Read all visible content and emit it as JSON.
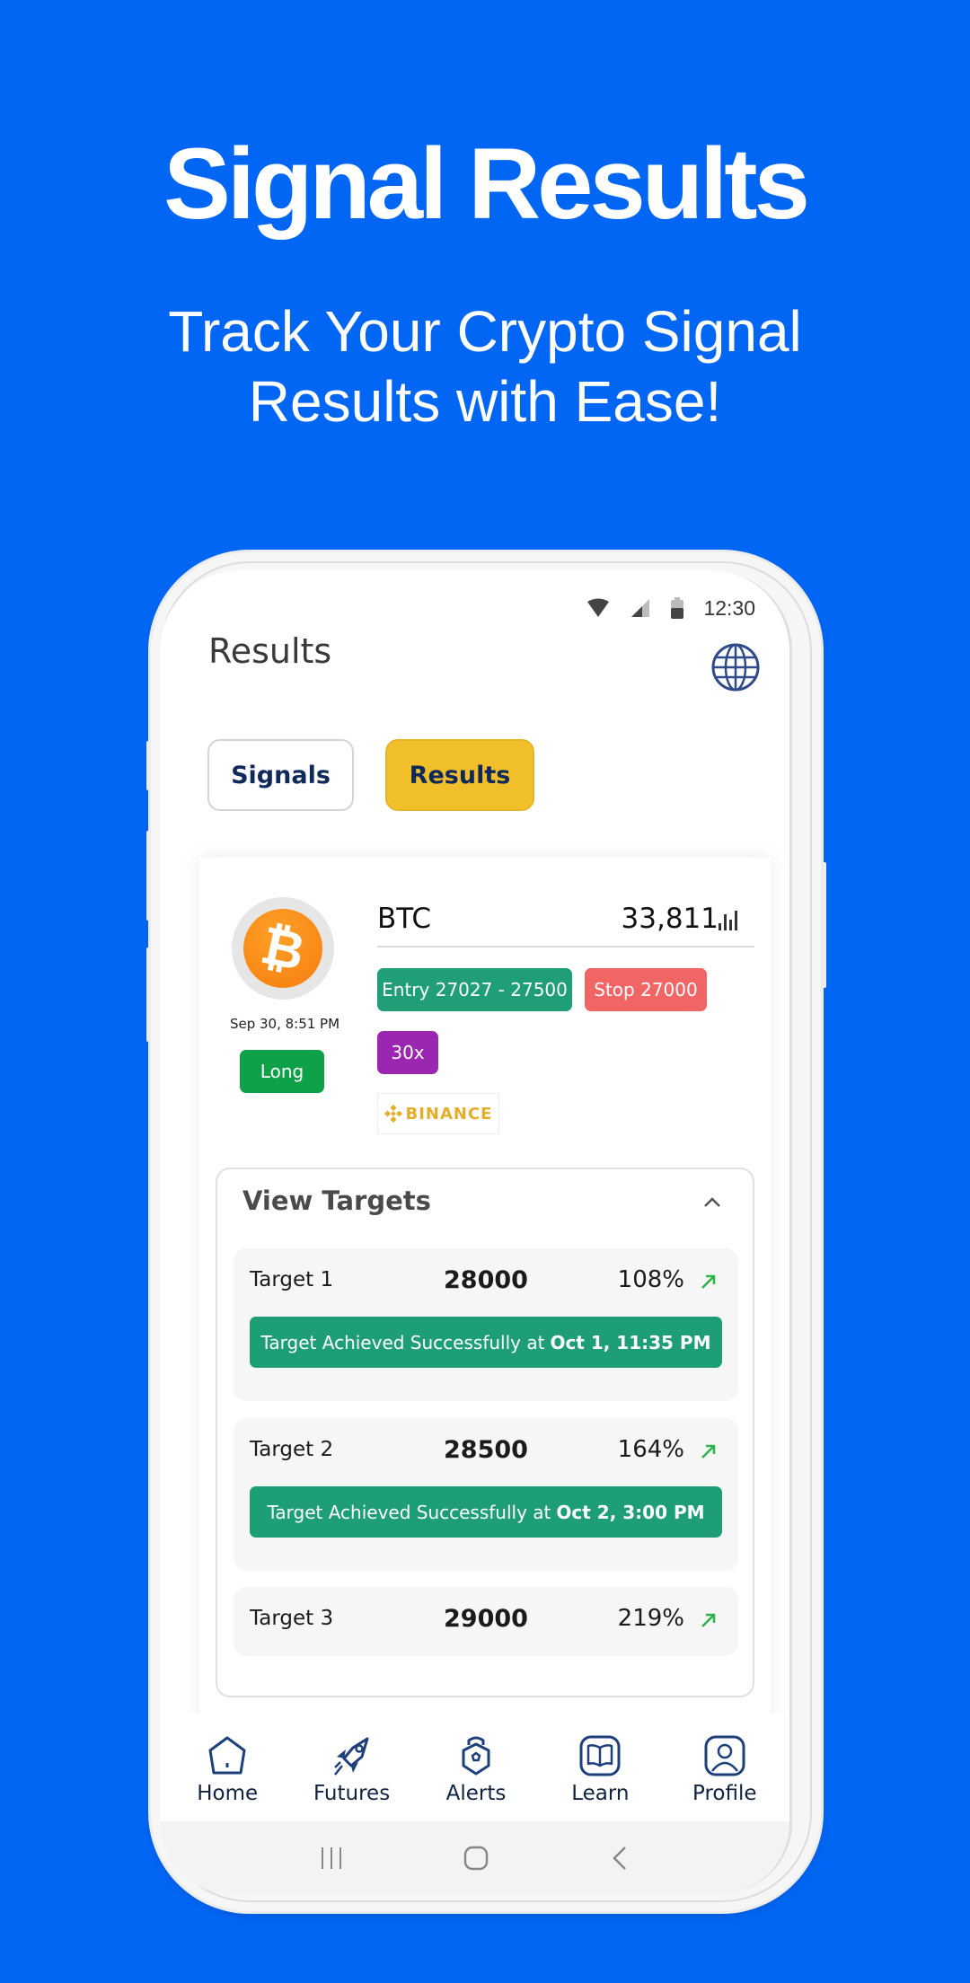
{
  "hero": {
    "title": "Signal Results",
    "subtitle_line1": "Track Your Crypto Signal",
    "subtitle_line2": "Results with Ease!"
  },
  "colors": {
    "background": "#0166f4",
    "tab_active": "#f0bf2a",
    "entry": "#1f9e77",
    "stop": "#f26565",
    "leverage": "#9b27b0",
    "long": "#0ea147",
    "nav_icon": "#1d3f7a"
  },
  "status_bar": {
    "time": "12:30",
    "icons": [
      "wifi-icon",
      "signal-icon",
      "battery-icon"
    ]
  },
  "app": {
    "title": "Results",
    "language_icon": "globe-icon",
    "tabs": [
      {
        "label": "Signals",
        "active": false
      },
      {
        "label": "Results",
        "active": true
      }
    ]
  },
  "signal": {
    "coin_icon": "bitcoin-icon",
    "symbol": "BTC",
    "price": "33,811",
    "price_icon": "bar-chart-icon",
    "date": "Sep 30, 8:51 PM",
    "direction": "Long",
    "entry": "Entry 27027 - 27500",
    "stop": "Stop 27000",
    "leverage": "30x",
    "exchange": "BINANCE",
    "targets_title": "View Targets",
    "targets_expanded": true,
    "targets": [
      {
        "name": "Target 1",
        "price": "28000",
        "percent": "108%",
        "status": "Target Achieved Successfully at",
        "time": "Oct 1, 11:35 PM"
      },
      {
        "name": "Target 2",
        "price": "28500",
        "percent": "164%",
        "status": "Target Achieved Successfully at",
        "time": "Oct 2, 3:00 PM"
      },
      {
        "name": "Target 3",
        "price": "29000",
        "percent": "219%"
      }
    ]
  },
  "bottom_nav": [
    {
      "label": "Home",
      "icon": "home-icon"
    },
    {
      "label": "Futures",
      "icon": "rocket-icon"
    },
    {
      "label": "Alerts",
      "icon": "alert-lock-icon"
    },
    {
      "label": "Learn",
      "icon": "book-icon"
    },
    {
      "label": "Profile",
      "icon": "profile-icon"
    }
  ],
  "system_nav": [
    "recents-button",
    "home-button",
    "back-button"
  ]
}
